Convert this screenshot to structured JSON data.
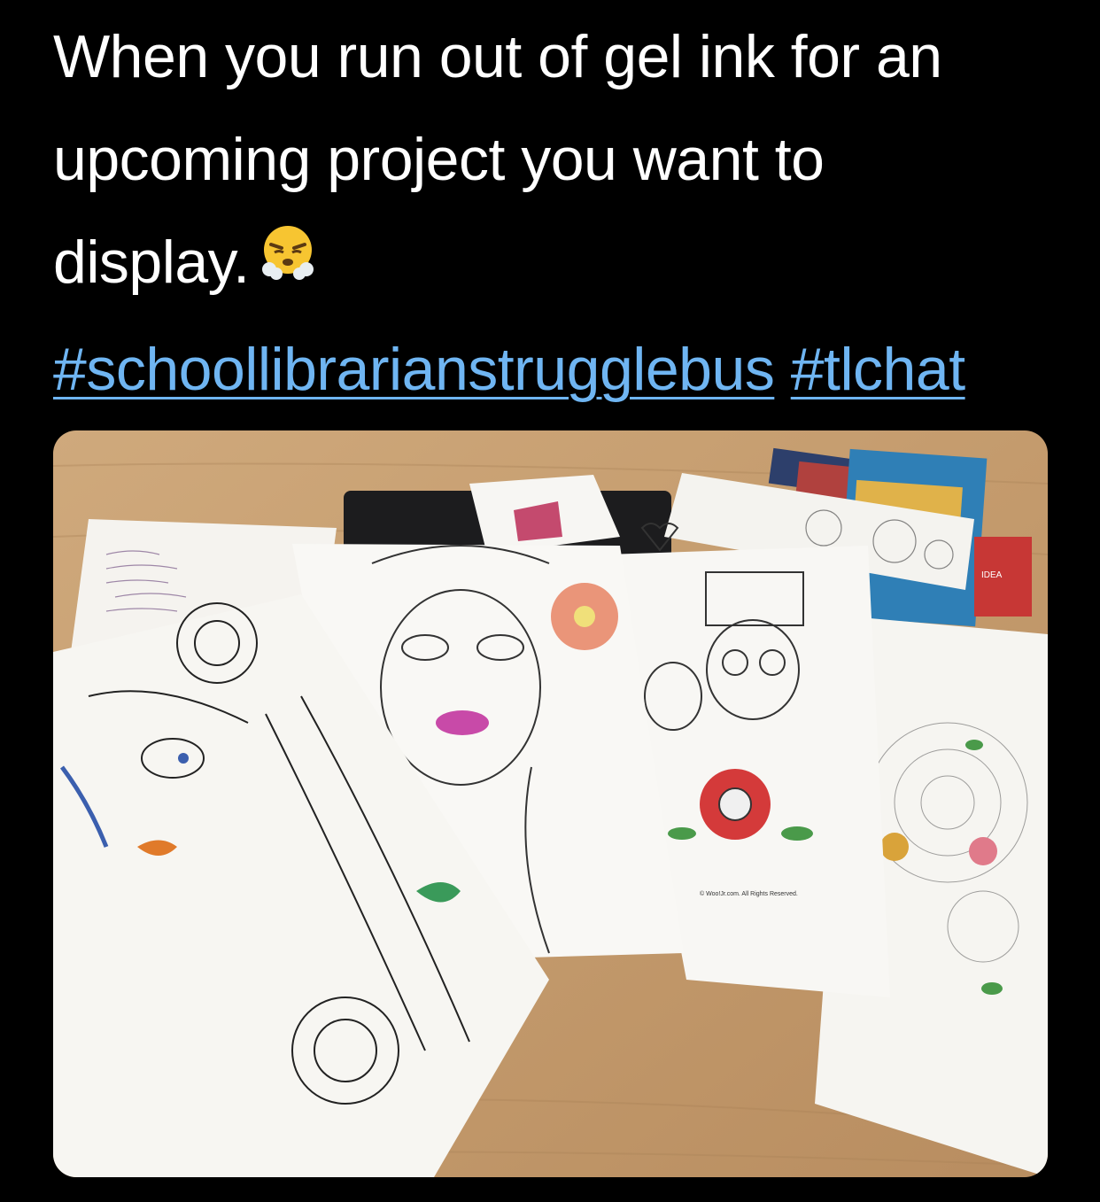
{
  "tweet": {
    "line1": "When you run out of gel ink for an",
    "line2": "upcoming project you want to",
    "line3": "display.",
    "emoji": "face-with-steam-from-nose",
    "hashtags": [
      "#schoollibrarianstrugglebus",
      "#tlchat"
    ]
  },
  "photo": {
    "watermark": "© Woo!Jr.com. All Rights Reserved.",
    "book_spine_label": "IDEA"
  },
  "colors": {
    "background": "#000000",
    "text": "#ffffff",
    "link": "#6fb5f2"
  }
}
